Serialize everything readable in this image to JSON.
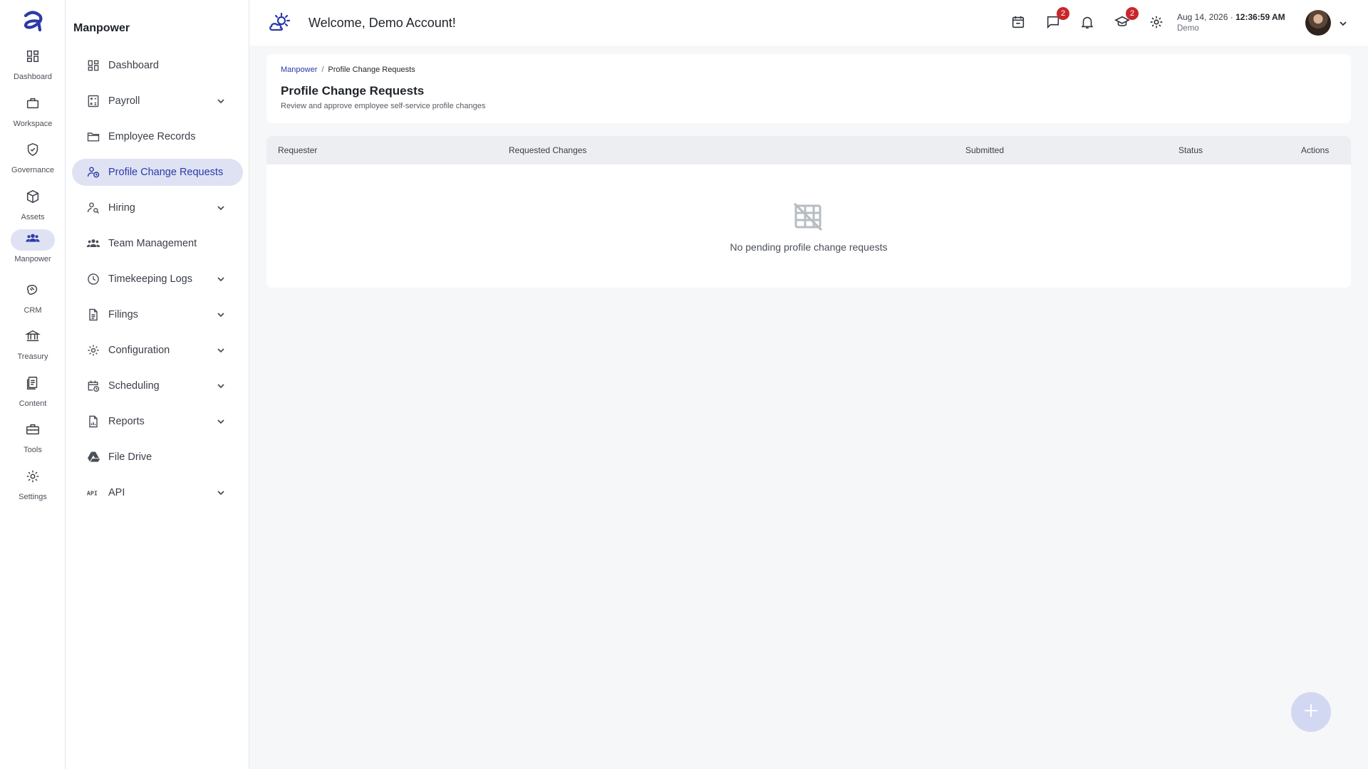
{
  "rail": {
    "logo": "brand-a-logo",
    "items": [
      {
        "label": "Dashboard",
        "icon": "grid-icon"
      },
      {
        "label": "Workspace",
        "icon": "briefcase-icon"
      },
      {
        "label": "Governance",
        "icon": "shield-check-icon"
      },
      {
        "label": "Assets",
        "icon": "cube-icon"
      },
      {
        "label": "Manpower",
        "icon": "people-icon",
        "active": true
      },
      {
        "label": "CRM",
        "icon": "handshake-icon"
      },
      {
        "label": "Treasury",
        "icon": "bank-icon"
      },
      {
        "label": "Content",
        "icon": "document-icon"
      },
      {
        "label": "Tools",
        "icon": "toolbox-icon"
      },
      {
        "label": "Settings",
        "icon": "gear-icon"
      }
    ]
  },
  "sidebar": {
    "title": "Manpower",
    "items": [
      {
        "label": "Dashboard",
        "icon": "grid-icon",
        "expandable": false
      },
      {
        "label": "Payroll",
        "icon": "calculator-icon",
        "expandable": true
      },
      {
        "label": "Employee Records",
        "icon": "folder-icon",
        "expandable": false
      },
      {
        "label": "Profile Change Requests",
        "icon": "person-clock-icon",
        "expandable": false,
        "active": true
      },
      {
        "label": "Hiring",
        "icon": "person-search-icon",
        "expandable": true
      },
      {
        "label": "Team Management",
        "icon": "team-icon",
        "expandable": false
      },
      {
        "label": "Timekeeping Logs",
        "icon": "clock-icon",
        "expandable": true
      },
      {
        "label": "Filings",
        "icon": "file-icon",
        "expandable": true
      },
      {
        "label": "Configuration",
        "icon": "gear-icon",
        "expandable": true
      },
      {
        "label": "Scheduling",
        "icon": "calendar-clock-icon",
        "expandable": true
      },
      {
        "label": "Reports",
        "icon": "report-icon",
        "expandable": true
      },
      {
        "label": "File Drive",
        "icon": "drive-icon",
        "expandable": false
      },
      {
        "label": "API",
        "icon": "api-icon",
        "expandable": true
      }
    ]
  },
  "header": {
    "welcome": "Welcome, Demo Account!",
    "messages_badge": "2",
    "learning_badge": "2",
    "date": "Aug 14, 2026",
    "time": "12:36:59 AM",
    "user_label": "Demo"
  },
  "page": {
    "breadcrumb": {
      "parent": "Manpower",
      "separator": "/",
      "current": "Profile Change Requests"
    },
    "title": "Profile Change Requests",
    "subtitle": "Review and approve employee self-service profile changes"
  },
  "table": {
    "columns": [
      "Requester",
      "Requested Changes",
      "Submitted",
      "Status",
      "Actions"
    ],
    "rows": [],
    "empty_message": "No pending profile change requests"
  },
  "colors": {
    "accent": "#2b3aa8",
    "active_bg": "#dfe2f3",
    "badge": "#c9262b"
  }
}
